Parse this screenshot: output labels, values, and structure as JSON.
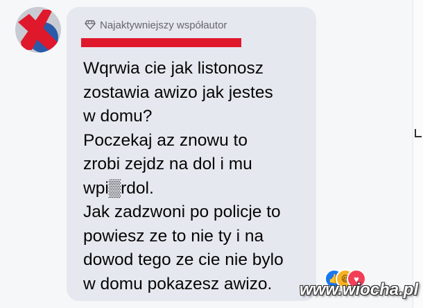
{
  "comment": {
    "author_badge": "Najaktywniejszy współautor",
    "badge_icon": "diamond-icon",
    "lines": [
      "Wqrwia cie jak listonosz",
      "zostawia awizo jak jestes",
      "w domu?",
      "Poczekaj az znowu to",
      "zrobi zejdz na dol i mu",
      "wpi▒rdol.",
      "Jak zadzwoni po policje to",
      "powiesz ze to nie ty i na",
      "dowod tego ze cie nie bylo",
      "w domu pokazesz awizo."
    ],
    "reactions": [
      "like-icon",
      "haha-icon",
      "love-icon"
    ]
  },
  "colors": {
    "bubble": "#e6e8ef",
    "redaction": "#e0182c",
    "like": "#1877f2",
    "haha": "#f7b125",
    "love": "#f33e58"
  },
  "watermark": "www.wiocha.pl"
}
